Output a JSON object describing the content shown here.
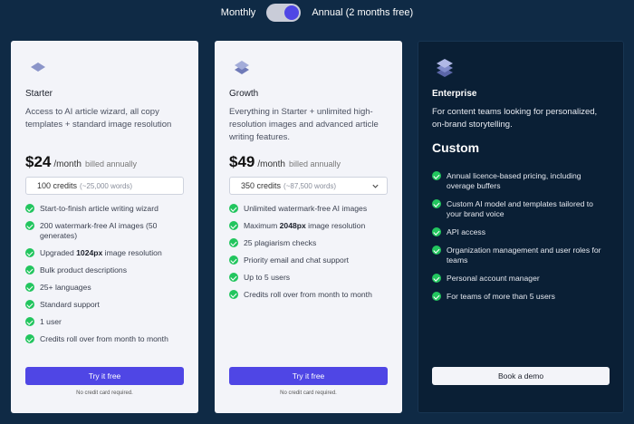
{
  "billing_toggle": {
    "monthly_label": "Monthly",
    "annual_label": "Annual (2 months free)",
    "state": "annual"
  },
  "colors": {
    "background": "#0f2a45",
    "accent": "#4f46e5",
    "check": "#22c55e"
  },
  "plans": [
    {
      "name": "Starter",
      "description": "Access to AI article wizard, all copy templates + standard image resolution",
      "price": "$24",
      "per": "/month",
      "billed": "billed annually",
      "credits_main": "100 credits",
      "credits_sub": "(~25,000 words)",
      "features": [
        "Start-to-finish article writing wizard",
        "200 watermark-free AI images (50 generates)",
        "Upgraded 1024px image resolution",
        "Bulk product descriptions",
        "25+ languages",
        "Standard support",
        "1 user",
        "Credits roll over from month to month"
      ],
      "cta": "Try it free",
      "note": "No credit card required."
    },
    {
      "name": "Growth",
      "description": "Everything in Starter + unlimited high-resolution images and advanced article writing features.",
      "price": "$49",
      "per": "/month",
      "billed": "billed annually",
      "credits_main": "350 credits",
      "credits_sub": "(~87,500 words)",
      "features": [
        "Unlimited watermark-free AI images",
        "Maximum 2048px image resolution",
        "25 plagiarism checks",
        "Priority email and chat support",
        "Up to 5 users",
        "Credits roll over from month to month"
      ],
      "cta": "Try it free",
      "note": "No credit card required."
    },
    {
      "name": "Enterprise",
      "description": "For content teams looking for personalized, on-brand storytelling.",
      "price": "Custom",
      "features": [
        "Annual licence-based pricing, including overage buffers",
        "Custom AI model and templates tailored to your brand voice",
        "API access",
        "Organization management and user roles for teams",
        "Personal account manager",
        "For teams of more than 5 users"
      ],
      "cta": "Book a demo"
    }
  ]
}
